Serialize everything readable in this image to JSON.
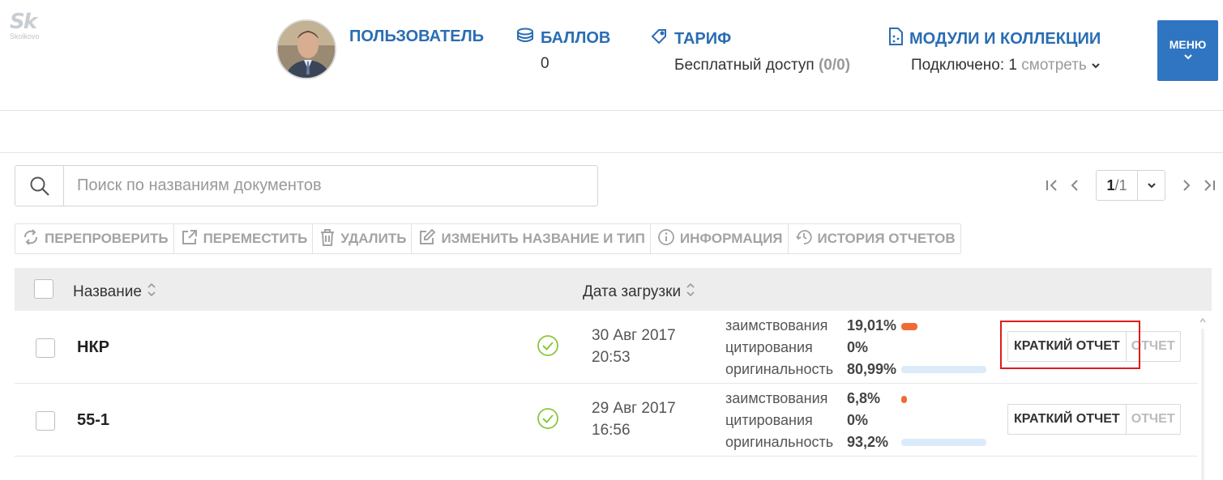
{
  "header": {
    "logo_text": "Sk",
    "logo_sub": "Skolkovo",
    "user_label": "ПОЛЬЗОВАТЕЛЬ",
    "points_label": "БАЛЛОВ",
    "points_value": "0",
    "tariff_label": "ТАРИФ",
    "tariff_value": "Бесплатный доступ",
    "tariff_count": "(0/0)",
    "modules_label": "МОДУЛИ И КОЛЛЕКЦИИ",
    "modules_connected_label": "Подключено: 1",
    "modules_view_label": "смотреть",
    "menu_label": "МЕНЮ"
  },
  "search": {
    "placeholder": "Поиск по названиям документов"
  },
  "pager": {
    "current": "1",
    "total": "/1"
  },
  "toolbar": {
    "recheck": "ПЕРЕПРОВЕРИТЬ",
    "move": "ПЕРЕМЕСТИТЬ",
    "delete": "УДАЛИТЬ",
    "rename": "ИЗМЕНИТЬ НАЗВАНИЕ И ТИП",
    "info": "ИНФОРМАЦИЯ",
    "history": "ИСТОРИЯ ОТЧЕТОВ"
  },
  "table": {
    "col_name": "Название",
    "col_date": "Дата загрузки",
    "rows": [
      {
        "name": "НКР",
        "date": "30 Авг 2017",
        "time": "20:53",
        "borrow_label": "заимствования",
        "borrow_value": "19,01%",
        "borrow_frac": 0.1901,
        "cite_label": "цитирования",
        "cite_value": "0%",
        "orig_label": "оригинальность",
        "orig_value": "80,99%",
        "short_report": "КРАТКИЙ ОТЧЕТ",
        "full_report": "ОТЧЕТ"
      },
      {
        "name": "55-1",
        "date": "29 Авг 2017",
        "time": "16:56",
        "borrow_label": "заимствования",
        "borrow_value": "6,8%",
        "borrow_frac": 0.068,
        "cite_label": "цитирования",
        "cite_value": "0%",
        "orig_label": "оригинальность",
        "orig_value": "93,2%",
        "short_report": "КРАТКИЙ ОТЧЕТ",
        "full_report": "ОТЧЕТ"
      }
    ]
  },
  "colors": {
    "accent": "#2f75c2",
    "borrow": "#f06a35",
    "original": "#dcebf9",
    "ok": "#8cc63f",
    "highlight": "#e01b1b"
  }
}
